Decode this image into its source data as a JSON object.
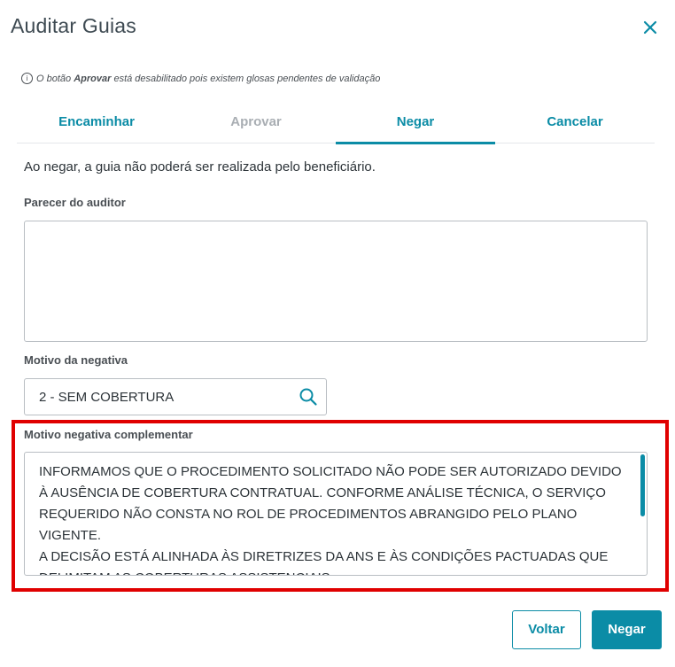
{
  "modal": {
    "title": "Auditar Guias",
    "close_icon": "close-icon"
  },
  "info": {
    "icon": "info-icon",
    "prefix": "O botão ",
    "bold": "Aprovar",
    "suffix": " está desabilitado pois existem glosas pendentes de validação"
  },
  "tabs": [
    {
      "label": "Encaminhar",
      "state": "enabled"
    },
    {
      "label": "Aprovar",
      "state": "disabled"
    },
    {
      "label": "Negar",
      "state": "active"
    },
    {
      "label": "Cancelar",
      "state": "enabled"
    }
  ],
  "description": "Ao negar, a guia não poderá ser realizada pelo beneficiário.",
  "parecer": {
    "label": "Parecer do auditor",
    "value": ""
  },
  "motivo": {
    "label": "Motivo da negativa",
    "value": "2 - SEM COBERTURA",
    "icon": "search-icon"
  },
  "complementar": {
    "label": "Motivo negativa complementar",
    "value": "INFORMAMOS QUE O PROCEDIMENTO SOLICITADO NÃO PODE SER AUTORIZADO DEVIDO À AUSÊNCIA DE COBERTURA CONTRATUAL. CONFORME ANÁLISE TÉCNICA, O SERVIÇO REQUERIDO NÃO CONSTA NO ROL DE PROCEDIMENTOS ABRANGIDO PELO PLANO VIGENTE.\nA DECISÃO ESTÁ ALINHADA ÀS DIRETRIZES DA ANS E ÀS CONDIÇÕES PACTUADAS QUE DELIMITAM AS COBERTURAS ASSISTENCIAIS."
  },
  "buttons": {
    "voltar": "Voltar",
    "negar": "Negar"
  },
  "colors": {
    "accent": "#0b8ca6",
    "disabled": "#a9aeb3",
    "highlight": "#e00000"
  }
}
